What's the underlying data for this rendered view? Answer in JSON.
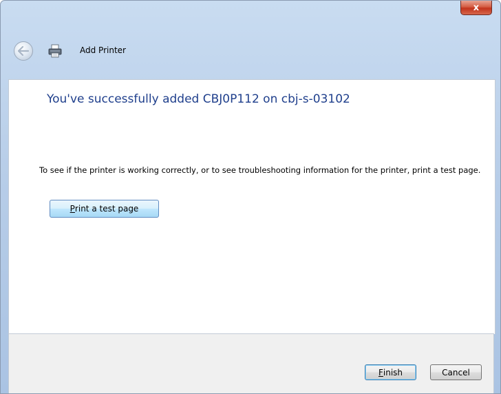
{
  "window": {
    "title": "Add Printer",
    "close_label": "x"
  },
  "content": {
    "heading": "You've successfully added CBJ0P112 on cbj-s-03102",
    "description": "To see if the printer is working correctly, or to see troubleshooting information for the printer, print a test page.",
    "test_button": {
      "accel": "P",
      "rest": "rint a test page"
    }
  },
  "footer": {
    "finish": {
      "accel": "F",
      "rest": "inish"
    },
    "cancel_label": "Cancel"
  },
  "icons": {
    "back": "back-arrow-icon",
    "printer": "printer-icon",
    "close": "close-icon"
  }
}
